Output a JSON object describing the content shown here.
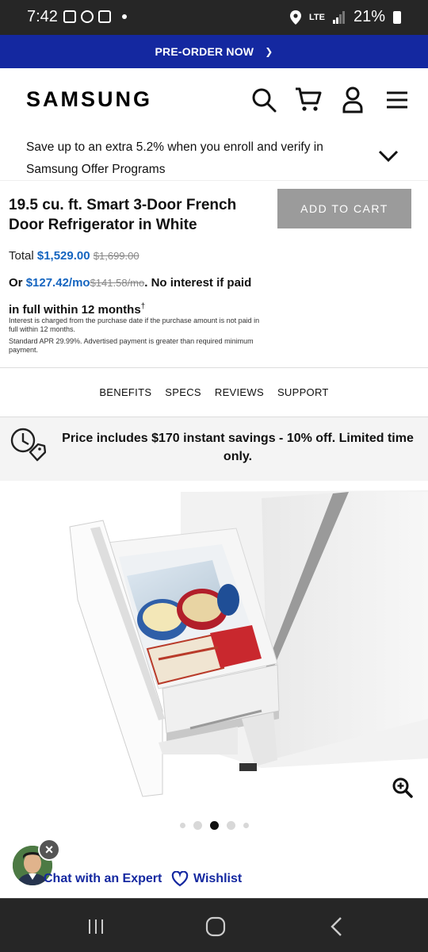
{
  "status_bar": {
    "time": "7:42",
    "network": "LTE",
    "battery": "21%"
  },
  "banner": {
    "label": "PRE-ORDER NOW",
    "chevron": "❯"
  },
  "header": {
    "logo": "SAMSUNG",
    "icons": [
      "search-icon",
      "cart-icon",
      "account-icon",
      "menu-icon"
    ]
  },
  "offer": {
    "text": "Save up to an extra 5.2% when you enroll and verify in Samsung Offer Programs"
  },
  "product": {
    "title": "19.5 cu. ft. Smart 3-Door French Door Refrigerator in White",
    "add_to_cart": "ADD TO CART",
    "total_label": "Total",
    "price": "$1,529.00",
    "original_price": "$1,699.00",
    "or_label": "Or",
    "monthly": "$127.42/mo",
    "monthly_original": "$141.58/mo",
    "monthly_suffix": ". No interest if paid in full within 12 months",
    "dagger": "†",
    "fine_print_1": "Interest is charged from the purchase date if the purchase amount is not paid in full within 12 months.",
    "fine_print_2": "Standard APR 29.99%. Advertised payment is greater than required minimum payment."
  },
  "tabs": [
    "BENEFITS",
    "SPECS",
    "REVIEWS",
    "SUPPORT"
  ],
  "savings": {
    "text": "Price includes $170 instant savings - 10% off. Limited time only."
  },
  "carousel": {
    "total": 5,
    "active": 2
  },
  "actions": {
    "chat": "Chat with an Expert",
    "wishlist": "Wishlist"
  },
  "colors": {
    "brand_blue": "#1428a0",
    "price_blue": "#1565c0",
    "button_gray": "#9b9b9b"
  }
}
